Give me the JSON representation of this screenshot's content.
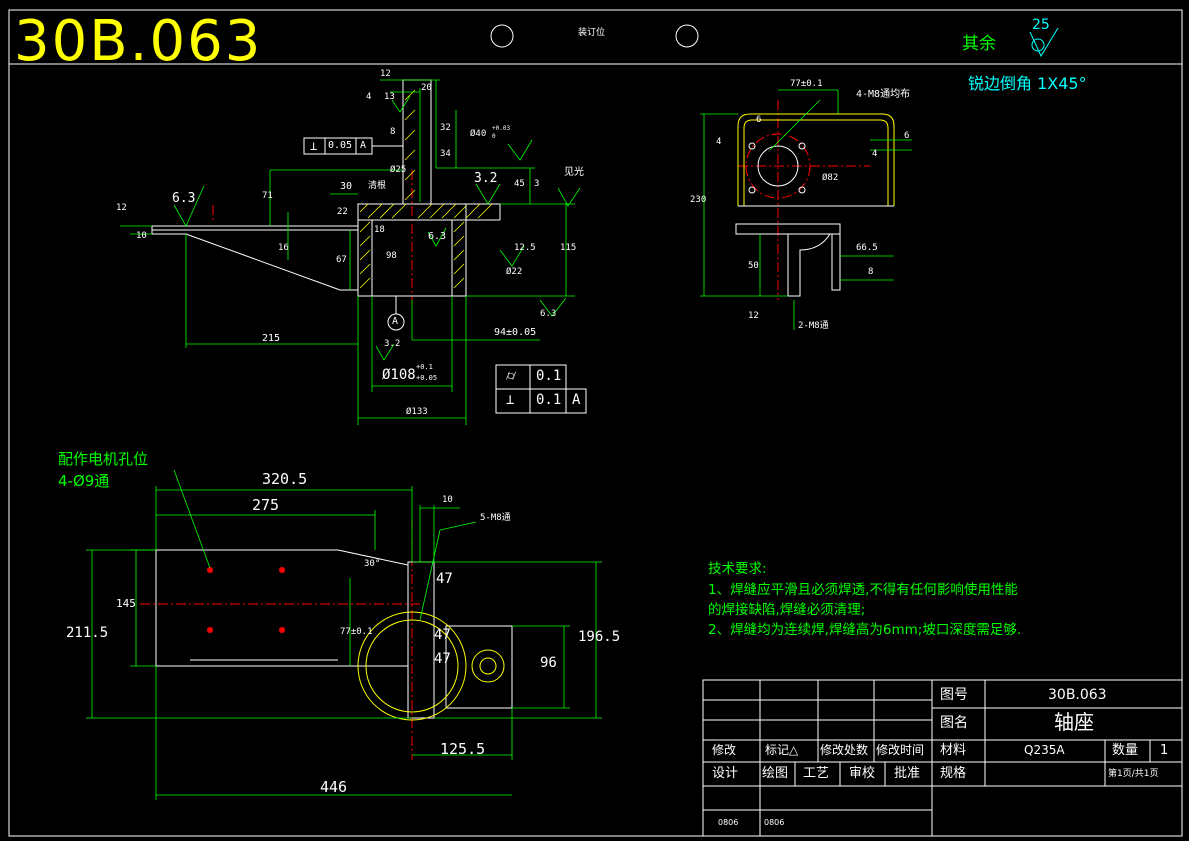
{
  "header": {
    "drawing_number_large": "30B.063",
    "binding_position_label": "装订位",
    "rest_roughness_label": "其余",
    "rest_roughness_value": "25",
    "edge_note": "锐边倒角 1X45°"
  },
  "notes": {
    "motor_hole_line1": "配作电机孔位",
    "motor_hole_line2": "4-Ø9通",
    "tech_requirements_title": "技术要求:",
    "tech_requirement_1a": "1、焊缝应平滑且必须焊透,不得有任何影响使用性能",
    "tech_requirement_1b": "的焊接缺陷,焊缝必须清理;",
    "tech_requirement_2": "2、焊缝均为连续焊,焊缝高为6mm;坡口深度需足够."
  },
  "front_view": {
    "dims": {
      "d12_top": "12",
      "d20": "20",
      "d4": "4",
      "d13": "13",
      "d32": "32",
      "d8": "8",
      "d34": "34",
      "d40": "Ø40",
      "d40_tol": "+0.03",
      "d40_tol2": "0",
      "d30": "30",
      "d71": "71",
      "d_phi25": "Ø25",
      "d3_2a": "3.2",
      "d45": "45",
      "d3": "3",
      "d6_3_left": "6.3",
      "d12_left": "12",
      "d10_left": "10",
      "d22": "22",
      "d18": "18",
      "d16": "16",
      "d67": "67",
      "d98": "98",
      "d6_3_mid": "6.3",
      "d12_5": "12.5",
      "d22b": "Ø22",
      "d115": "115",
      "d6_3_right": "6.3",
      "d215": "215",
      "d94": "94±0.05",
      "d3_2b": "3.2",
      "d108": "Ø108",
      "d108_tol1": "+0.1",
      "d108_tol2": "+0.05",
      "d133": "Ø133",
      "weld_clean": "清根",
      "section_label": "A",
      "finish_note": "见光"
    },
    "fcf_top": {
      "symbol": "⊥",
      "value": "0.05",
      "datum": "A"
    },
    "fcf_bottom_1": {
      "symbol": "⌭",
      "value": "0.1"
    },
    "fcf_bottom_2": {
      "symbol": "⊥",
      "value": "0.1",
      "datum": "A"
    }
  },
  "side_view": {
    "dims": {
      "d77": "77±0.1",
      "m8": "4-M8通均布",
      "d6a": "6",
      "d4a": "4",
      "d6b": "6",
      "d4b": "4",
      "d82": "Ø82",
      "d230": "230",
      "d66_5": "66.5",
      "d8": "8",
      "d50": "50",
      "d12": "12",
      "m8b": "2-M8通"
    }
  },
  "plan_view": {
    "dims": {
      "d320_5": "320.5",
      "d275": "275",
      "d10": "10",
      "m8": "5-M8通",
      "d30deg": "30°",
      "d47a": "47",
      "d47b": "47",
      "d47c": "47",
      "d145": "145",
      "d211_5": "211.5",
      "d77": "77±0.1",
      "d96": "96",
      "d196_5": "196.5",
      "d125_5": "125.5",
      "d446": "446"
    }
  },
  "title_block": {
    "label_drawing_no": "图号",
    "drawing_no": "30B.063",
    "label_name": "图名",
    "part_name": "轴座",
    "label_material": "材料",
    "material": "Q235A",
    "label_quantity": "数量",
    "quantity": "1",
    "label_spec": "规格",
    "sheet_info": "第1页/共1页",
    "rev_headers": [
      "修改",
      "标记△",
      "修改处数",
      "修改时间"
    ],
    "role_headers": [
      "设计",
      "绘图",
      "工艺",
      "审校",
      "批准"
    ],
    "dates": [
      "0806",
      "0806"
    ]
  }
}
